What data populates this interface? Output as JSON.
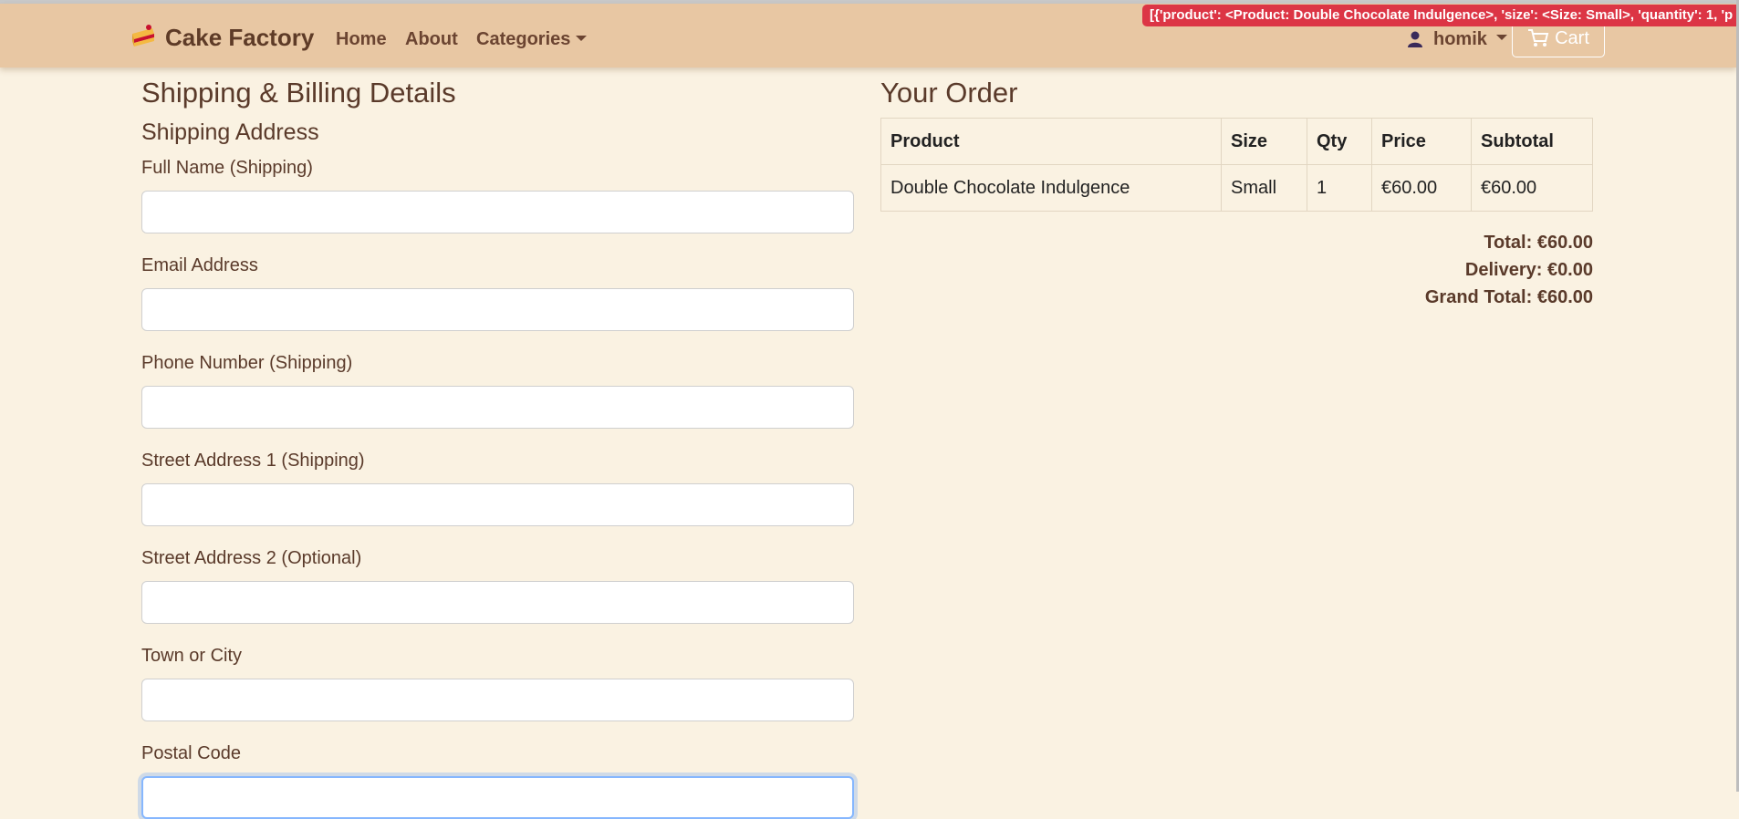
{
  "navbar": {
    "brand": "Cake Factory",
    "links": [
      "Home",
      "About",
      "Categories"
    ],
    "user": "homik",
    "cart": "Cart"
  },
  "debug_message": "[{'product': <Product: Double Chocolate Indulgence>, 'size': <Size: Small>, 'quantity': 1, 'p",
  "checkout": {
    "heading": "Shipping & Billing Details",
    "subheading": "Shipping Address",
    "fields": [
      {
        "label": "Full Name (Shipping)",
        "value": ""
      },
      {
        "label": "Email Address",
        "value": ""
      },
      {
        "label": "Phone Number (Shipping)",
        "value": ""
      },
      {
        "label": "Street Address 1 (Shipping)",
        "value": ""
      },
      {
        "label": "Street Address 2 (Optional)",
        "value": ""
      },
      {
        "label": "Town or City",
        "value": ""
      },
      {
        "label": "Postal Code",
        "value": ""
      }
    ]
  },
  "order": {
    "heading": "Your Order",
    "columns": [
      "Product",
      "Size",
      "Qty",
      "Price",
      "Subtotal"
    ],
    "rows": [
      [
        "Double Chocolate Indulgence",
        "Small",
        "1",
        "€60.00",
        "€60.00"
      ]
    ],
    "total": "Total: €60.00",
    "delivery": "Delivery: €0.00",
    "grand_total": "Grand Total: €60.00"
  },
  "colors": {
    "navbar": "#e8c7a3",
    "page_background": "#faf2e2",
    "debug_badge": "#dc3545",
    "text": "#5a3a2a"
  },
  "icons": {
    "brand": "cake-slice-icon",
    "user": "user-icon",
    "cart": "cart-icon",
    "dropdown": "caret-down-icon"
  }
}
